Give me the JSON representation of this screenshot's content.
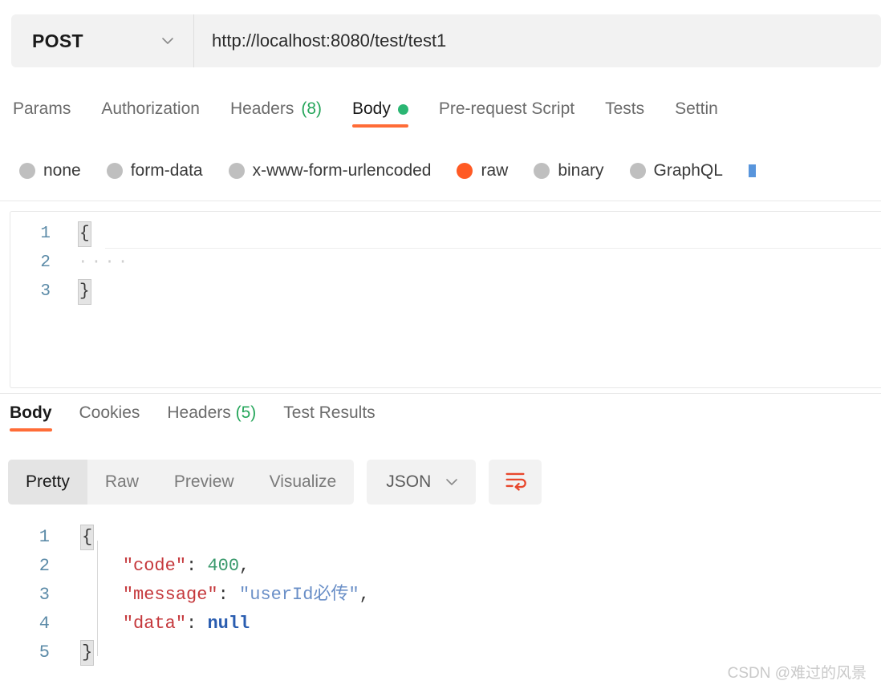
{
  "request": {
    "method": "POST",
    "method_caret_icon": "chevron-down-icon",
    "url": "http://localhost:8080/test/test1",
    "tabs": [
      {
        "label": "Params",
        "active": false
      },
      {
        "label": "Authorization",
        "active": false
      },
      {
        "label": "Headers",
        "count": "(8)",
        "active": false
      },
      {
        "label": "Body",
        "active": true,
        "indicator": "green-dot"
      },
      {
        "label": "Pre-request Script",
        "active": false
      },
      {
        "label": "Tests",
        "active": false
      },
      {
        "label": "Settin",
        "active": false
      }
    ],
    "body_types": [
      {
        "label": "none",
        "selected": false
      },
      {
        "label": "form-data",
        "selected": false
      },
      {
        "label": "x-www-form-urlencoded",
        "selected": false
      },
      {
        "label": "raw",
        "selected": true
      },
      {
        "label": "binary",
        "selected": false
      },
      {
        "label": "GraphQL",
        "selected": false
      }
    ],
    "body_lines": [
      {
        "no": "1",
        "kind": "brace",
        "text": "{"
      },
      {
        "no": "2",
        "kind": "dots",
        "text": "····"
      },
      {
        "no": "3",
        "kind": "brace",
        "text": "}"
      }
    ]
  },
  "response": {
    "tabs": [
      {
        "label": "Body",
        "active": true
      },
      {
        "label": "Cookies",
        "active": false
      },
      {
        "label": "Headers",
        "count": "(5)",
        "active": false
      },
      {
        "label": "Test Results",
        "active": false
      }
    ],
    "view_modes": [
      {
        "label": "Pretty",
        "active": true
      },
      {
        "label": "Raw",
        "active": false
      },
      {
        "label": "Preview",
        "active": false
      },
      {
        "label": "Visualize",
        "active": false
      }
    ],
    "format": "JSON",
    "format_caret_icon": "chevron-down-icon",
    "wrap_icon": "word-wrap-icon",
    "body": {
      "line1_no": "1",
      "line1_brace": "{",
      "line2_no": "2",
      "line2_key": "\"code\"",
      "line2_colon": ": ",
      "line2_value": "400",
      "line2_comma": ",",
      "line3_no": "3",
      "line3_key": "\"message\"",
      "line3_colon": ": ",
      "line3_value": "\"userId必传\"",
      "line3_comma": ",",
      "line4_no": "4",
      "line4_key": "\"data\"",
      "line4_colon": ": ",
      "line4_value": "null",
      "line5_no": "5",
      "line5_brace": "}"
    }
  },
  "watermark": "CSDN @难过的风景",
  "colors": {
    "accent": "#ff6c37",
    "success": "#2bb673",
    "key": "#c5383c",
    "number": "#3b9a6d",
    "string": "#6a8fc7",
    "null": "#2a5db0",
    "line_number": "#5c8ba8"
  }
}
